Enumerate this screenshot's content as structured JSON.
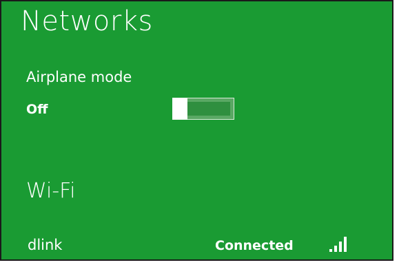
{
  "panel": {
    "title": "Networks",
    "background_color": "#1a9b33"
  },
  "airplane_mode": {
    "label": "Airplane mode",
    "state": "Off",
    "enabled": false
  },
  "wifi": {
    "heading": "Wi-Fi",
    "networks": [
      {
        "name": "dlink",
        "status": "Connected",
        "signal_icon": "wifi-signal-bars-icon",
        "signal_bars": 4
      }
    ]
  }
}
